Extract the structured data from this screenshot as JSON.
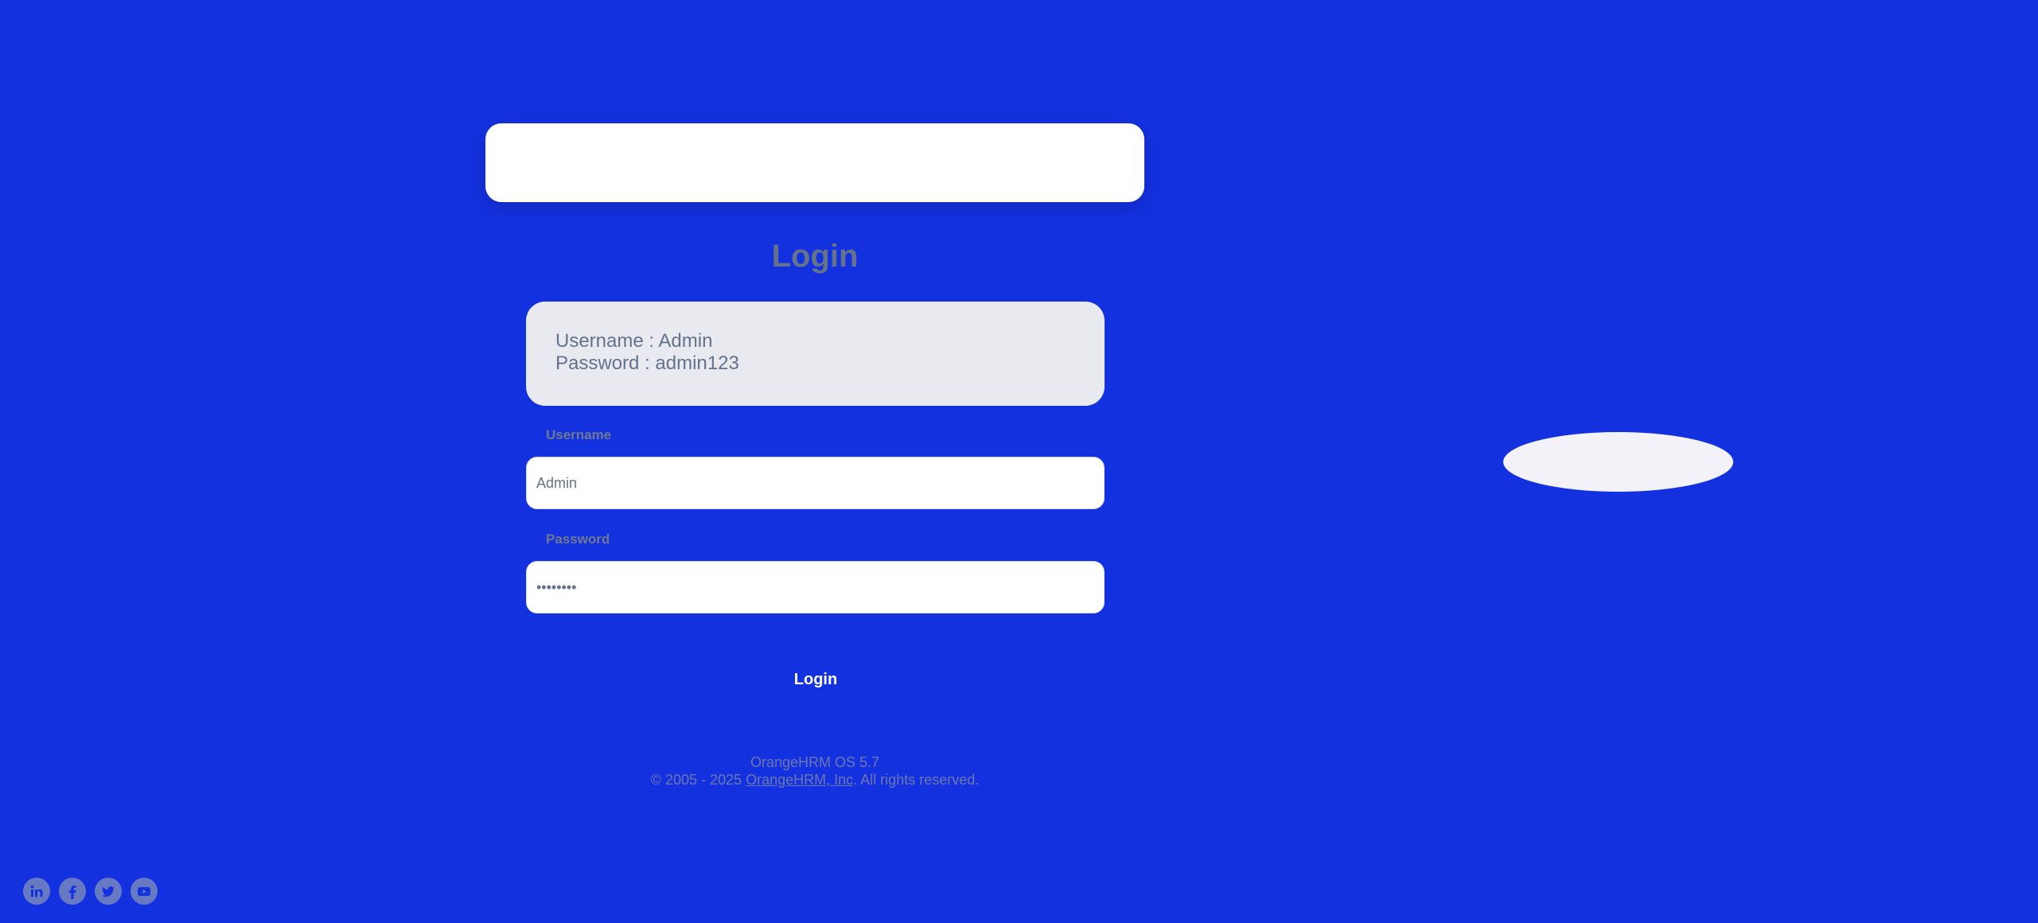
{
  "login": {
    "title": "Login",
    "credentials": {
      "username_line": "Username : Admin",
      "password_line": "Password : admin123"
    },
    "username": {
      "label": "Username",
      "value": "Admin"
    },
    "password": {
      "label": "Password",
      "value": "admin123"
    },
    "button_label": "Login"
  },
  "footer": {
    "version": "OrangeHRM OS 5.7",
    "copyright_prefix": "© 2005 - 2025 ",
    "company_link": "OrangeHRM, Inc",
    "copyright_suffix": ". All rights reserved."
  },
  "socials": [
    "linkedin-icon",
    "facebook-icon",
    "twitter-icon",
    "youtube-icon"
  ],
  "colors": {
    "background": "#1431e0",
    "card": "#ffffff",
    "credential_box": "#e8eaef",
    "muted_text": "#64728c"
  }
}
